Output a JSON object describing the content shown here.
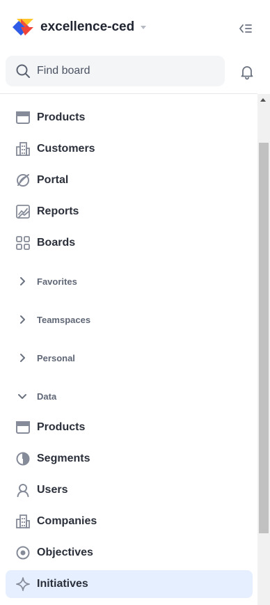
{
  "workspace": {
    "name": "excellence-ced"
  },
  "search": {
    "placeholder": "Find board"
  },
  "nav": {
    "top_items": [
      {
        "label": "Products",
        "icon": "window-icon"
      },
      {
        "label": "Customers",
        "icon": "building-icon"
      },
      {
        "label": "Portal",
        "icon": "portal-icon"
      },
      {
        "label": "Reports",
        "icon": "chart-icon"
      },
      {
        "label": "Boards",
        "icon": "grid-icon"
      }
    ],
    "sections": [
      {
        "label": "Favorites",
        "expanded": false
      },
      {
        "label": "Teamspaces",
        "expanded": false
      },
      {
        "label": "Personal",
        "expanded": false
      },
      {
        "label": "Data",
        "expanded": true
      }
    ],
    "data_items": [
      {
        "label": "Products",
        "icon": "window-icon"
      },
      {
        "label": "Segments",
        "icon": "pie-icon"
      },
      {
        "label": "Users",
        "icon": "user-icon"
      },
      {
        "label": "Companies",
        "icon": "building-icon"
      },
      {
        "label": "Objectives",
        "icon": "target-icon"
      },
      {
        "label": "Initiatives",
        "icon": "sparkle-icon",
        "active": true
      }
    ]
  },
  "colors": {
    "active_bg": "#e5efff",
    "icon": "#858b98",
    "text": "#2a2f3a"
  }
}
